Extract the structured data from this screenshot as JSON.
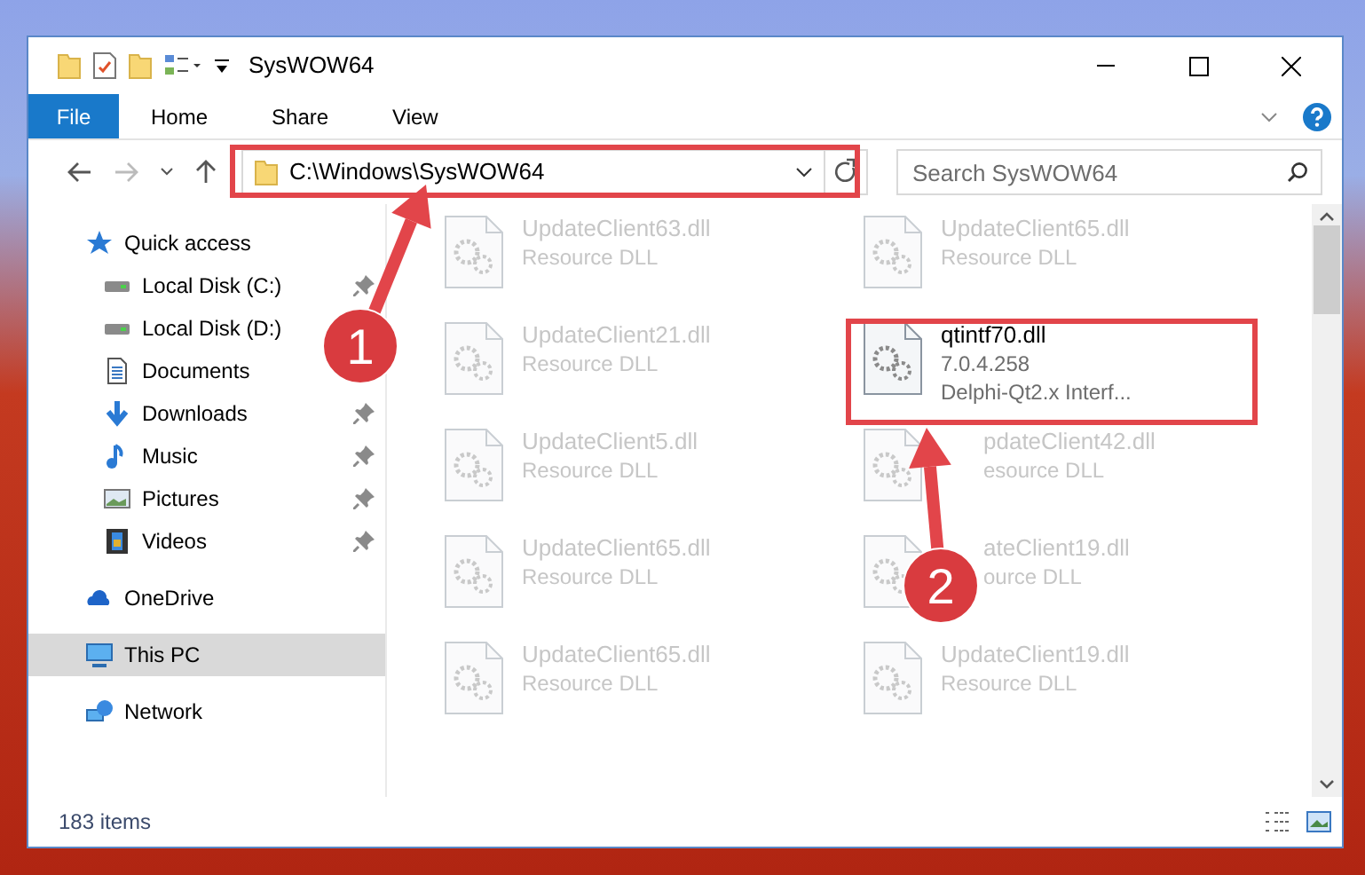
{
  "window": {
    "title": "SysWOW64"
  },
  "ribbon_tabs": [
    {
      "label": "File",
      "kind": "file",
      "selected": false
    },
    {
      "label": "Home",
      "kind": "tab",
      "selected": false
    },
    {
      "label": "Share",
      "kind": "tab",
      "selected": false
    },
    {
      "label": "View",
      "kind": "tab",
      "selected": false
    }
  ],
  "address_bar": {
    "path": "C:\\Windows\\SysWOW64"
  },
  "search": {
    "placeholder": "Search SysWOW64"
  },
  "sidebar": {
    "items": [
      {
        "label": "Quick access",
        "kind": "star",
        "selected": false,
        "children": [
          {
            "label": "Local Disk (C:)",
            "kind": "disk",
            "pinned": true,
            "selected": false
          },
          {
            "label": "Local Disk (D:)",
            "kind": "disk",
            "pinned": false,
            "selected": false
          },
          {
            "label": "Documents",
            "kind": "documents",
            "pinned": false,
            "selected": false
          },
          {
            "label": "Downloads",
            "kind": "download",
            "pinned": true,
            "selected": false
          },
          {
            "label": "Music",
            "kind": "music",
            "pinned": true,
            "selected": false
          },
          {
            "label": "Pictures",
            "kind": "pictures",
            "pinned": true,
            "selected": false
          },
          {
            "label": "Videos",
            "kind": "videos",
            "pinned": true,
            "selected": false
          }
        ]
      },
      {
        "label": "OneDrive",
        "kind": "cloud",
        "selected": false
      },
      {
        "label": "This PC",
        "kind": "pc",
        "selected": true
      },
      {
        "label": "Network",
        "kind": "network",
        "selected": false
      }
    ]
  },
  "files": [
    {
      "name": "UpdateClient63.dll",
      "line_2": "Resource DLL",
      "blurred": true
    },
    {
      "name": "UpdateClient65.dll",
      "line_2": "Resource DLL",
      "blurred": true
    },
    {
      "name": "UpdateClient21.dll",
      "line_2": "Resource DLL",
      "blurred": true
    },
    {
      "name": "qtintf70.dll",
      "line_2": "7.0.4.258",
      "line_3": "Delphi-Qt2.x Interf...",
      "blurred": false
    },
    {
      "name": "UpdateClient5.dll",
      "line_2": "Resource DLL",
      "blurred": true
    },
    {
      "name": "pdateClient42.dll",
      "line_2": "esource DLL",
      "blurred": true,
      "partly_covered": true
    },
    {
      "name": "UpdateClient65.dll",
      "line_2": "Resource DLL",
      "blurred": true
    },
    {
      "name": "ateClient19.dll",
      "line_2": "ource DLL",
      "blurred": true,
      "partly_covered": true
    },
    {
      "name": "UpdateClient65.dll",
      "line_2": "Resource DLL",
      "blurred": true
    },
    {
      "name": "UpdateClient19.dll",
      "line_2": "Resource DLL",
      "blurred": true
    }
  ],
  "status_bar": {
    "item_count": "183 items"
  },
  "annotations": [
    {
      "number": "1"
    },
    {
      "number": "2"
    }
  ]
}
